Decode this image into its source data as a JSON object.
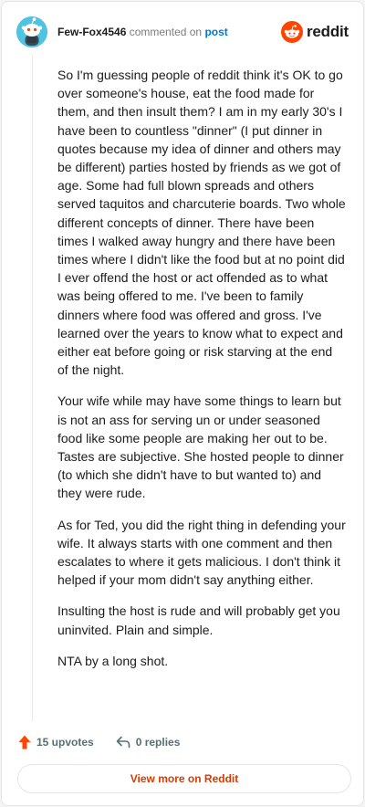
{
  "header": {
    "username": "Few-Fox4546",
    "action_text": "commented on",
    "post_link": "post",
    "logo_text": "reddit"
  },
  "comment": {
    "paragraphs": [
      "So I'm guessing people of reddit think it's OK to go over someone's house, eat the food made for them, and then insult them? I am in my early 30's I have been to countless \"dinner\" (I put dinner in quotes because my idea of dinner and others may be different) parties hosted by friends as we got of age. Some had full blown spreads and others served taquitos and charcuterie boards. Two whole different concepts of dinner. There have been times I walked away hungry and there have been times where I didn't like the food but at no point did I ever offend the host or act offended as to what was being offered to me. I've been to family dinners where food was offered and gross. I've learned over the years to know what to expect and either eat before going or risk starving at the end of the night.",
      "Your wife while may have some things to learn but is not an ass for serving un or under seasoned food like some people are making her out to be. Tastes are subjective. She hosted people to dinner (to which she didn't have to but wanted to) and they were rude.",
      "As for Ted, you did the right thing in defending your wife. It always starts with one comment and then escalates to where it gets malicious. I don't think it helped if your mom didn't say anything either.",
      "Insulting the host is rude and will probably get you uninvited. Plain and simple.",
      "NTA by a long shot."
    ]
  },
  "footer": {
    "upvotes": "15 upvotes",
    "replies": "0 replies",
    "view_more": "View more on Reddit"
  },
  "colors": {
    "upvote": "#ff4500",
    "link": "#0079d3",
    "view_more": "#d93a00",
    "avatar_bg": "#4fc4e0"
  },
  "icons": [
    "snoo-avatar-icon",
    "reddit-logo-icon",
    "upvote-arrow-icon",
    "reply-arrow-icon"
  ]
}
